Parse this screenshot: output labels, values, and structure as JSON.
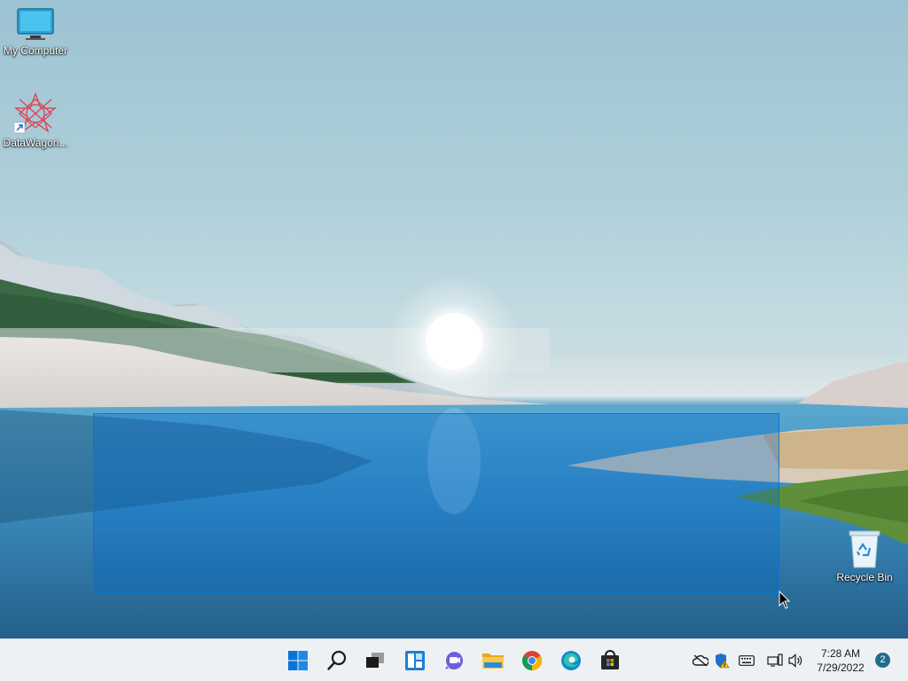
{
  "desktop": {
    "icons": [
      {
        "label": "My Computer",
        "icon": "monitor-icon"
      },
      {
        "label": "DataWagon...",
        "icon": "datawagon-app-icon"
      },
      {
        "label": "Recycle Bin",
        "icon": "recycle-bin-icon"
      }
    ],
    "selection_active": true
  },
  "taskbar": {
    "pinned": [
      {
        "name": "Start",
        "icon": "windows-start-icon"
      },
      {
        "name": "Search",
        "icon": "search-icon"
      },
      {
        "name": "Task View",
        "icon": "task-view-icon"
      },
      {
        "name": "Widgets",
        "icon": "widgets-icon"
      },
      {
        "name": "Chat",
        "icon": "teams-chat-icon"
      },
      {
        "name": "File Explorer",
        "icon": "folder-icon"
      },
      {
        "name": "Google Chrome",
        "icon": "chrome-icon"
      },
      {
        "name": "Microsoft Edge",
        "icon": "edge-icon"
      },
      {
        "name": "Microsoft Store",
        "icon": "store-icon"
      }
    ],
    "tray": {
      "icons": [
        "onedrive-offline-icon",
        "security-warning-icon",
        "keyboard-icon",
        "network-icon",
        "volume-icon"
      ],
      "time": "7:28 AM",
      "date": "7/29/2022",
      "notification_count": "2"
    }
  },
  "colors": {
    "accent": "#0078d4",
    "taskbar_bg": "#eef1f4",
    "selection_fill": "#0066cc"
  }
}
